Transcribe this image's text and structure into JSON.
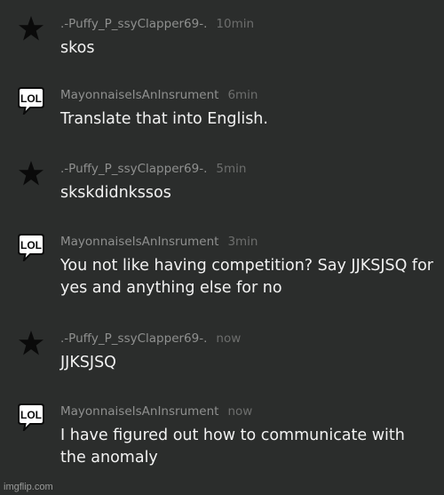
{
  "comments": [
    {
      "avatar": "star-icon",
      "username": ".-Puffy_P_ssyClapper69-.",
      "time": "10min",
      "text": "skos"
    },
    {
      "avatar": "lol-badge-icon",
      "avatar_label": "LOL",
      "username": "MayonnaiseIsAnInsrument",
      "time": "6min",
      "text": "Translate that into English."
    },
    {
      "avatar": "star-icon",
      "username": ".-Puffy_P_ssyClapper69-.",
      "time": "5min",
      "text": "skskdidnkssos"
    },
    {
      "avatar": "lol-badge-icon",
      "avatar_label": "LOL",
      "username": "MayonnaiseIsAnInsrument",
      "time": "3min",
      "text": "You not like having competition? Say JJKSJSQ for yes and anything else for no"
    },
    {
      "avatar": "star-icon",
      "username": ".-Puffy_P_ssyClapper69-.",
      "time": "now",
      "text": "JJKSJSQ"
    },
    {
      "avatar": "lol-badge-icon",
      "avatar_label": "LOL",
      "username": "MayonnaiseIsAnInsrument",
      "time": "now",
      "text": "I have figured out how to communicate with the anomaly"
    }
  ],
  "watermark": "imgflip.com",
  "colors": {
    "background": "#2b2d2c",
    "username": "#8f908f",
    "timestamp": "#6d6e6d",
    "body_text": "#f2f2f2"
  }
}
